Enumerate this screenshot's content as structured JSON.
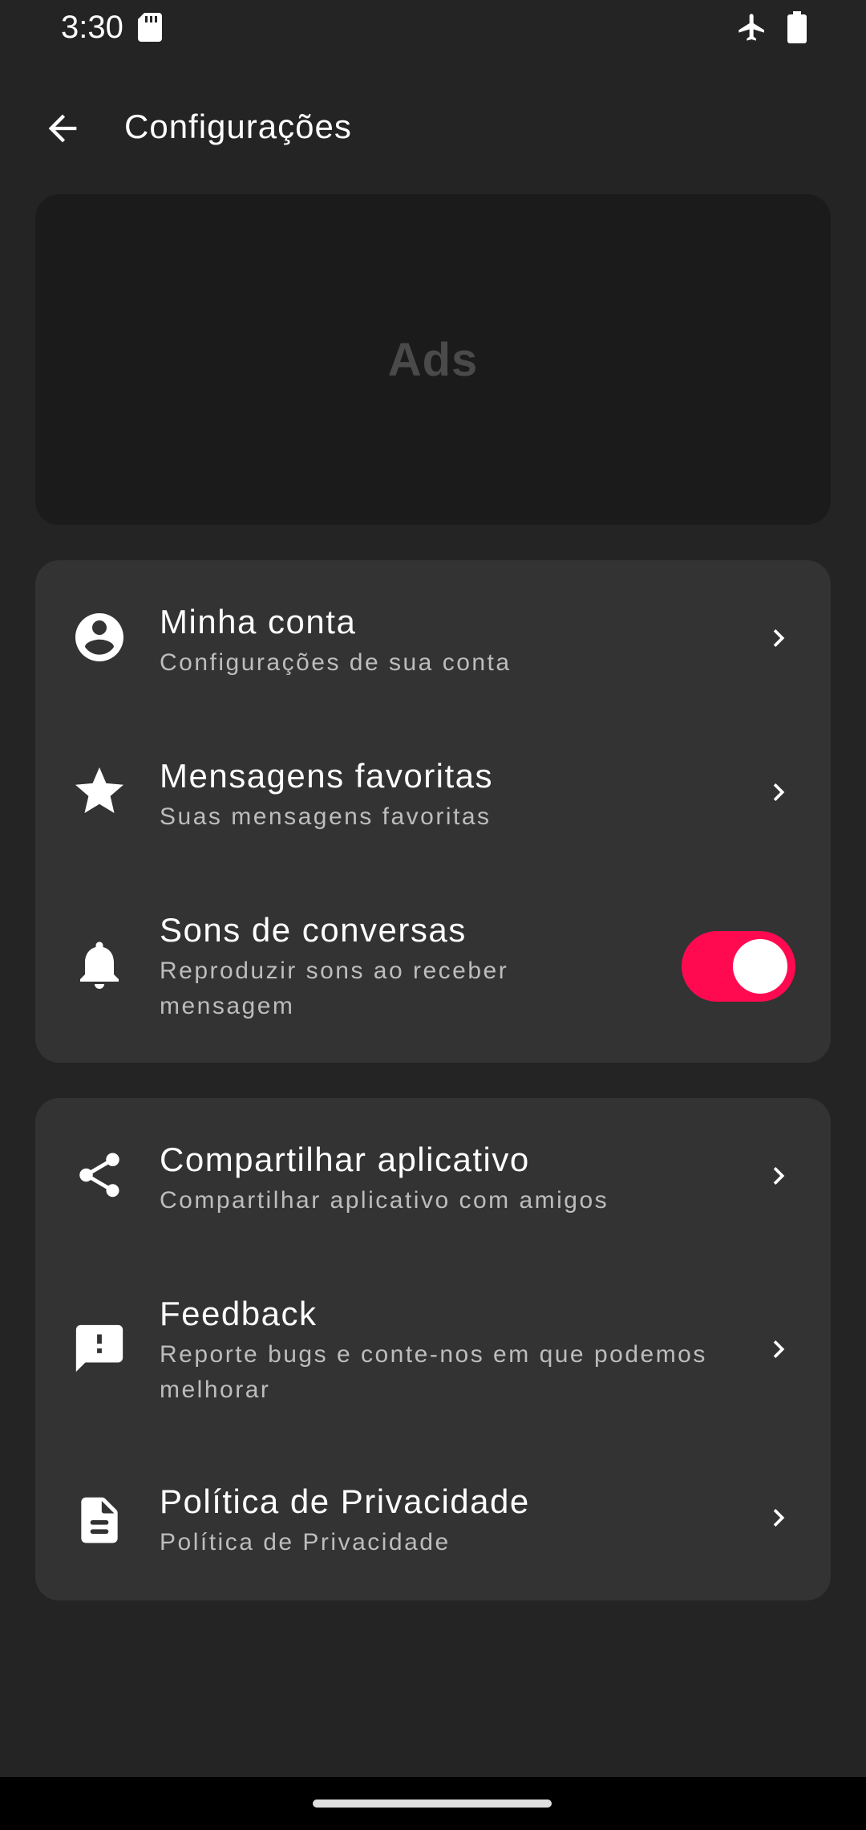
{
  "status_bar": {
    "time": "3:30"
  },
  "app_bar": {
    "title": "Configurações"
  },
  "ad": {
    "label": "Ads"
  },
  "colors": {
    "background": "#242424",
    "card": "#333333",
    "accent": "#ff0a50"
  },
  "section_account": [
    {
      "title": "Minha conta",
      "subtitle": "Configurações de sua conta",
      "icon": "account-circle-icon"
    },
    {
      "title": "Mensagens favoritas",
      "subtitle": "Suas mensagens favoritas",
      "icon": "star-icon"
    },
    {
      "title": "Sons de conversas",
      "subtitle_line1": "Reproduzir sons ao receber",
      "subtitle_line2": "mensagem",
      "icon": "bell-icon",
      "toggle_on": true
    }
  ],
  "section_app": [
    {
      "title": "Compartilhar aplicativo",
      "subtitle": "Compartilhar aplicativo com amigos",
      "icon": "share-icon"
    },
    {
      "title": "Feedback",
      "subtitle_line1": "Reporte bugs e conte-nos em que podemos",
      "subtitle_line2": "melhorar",
      "icon": "feedback-icon"
    },
    {
      "title": "Política de Privacidade",
      "subtitle": "Política de Privacidade",
      "icon": "document-icon"
    }
  ]
}
